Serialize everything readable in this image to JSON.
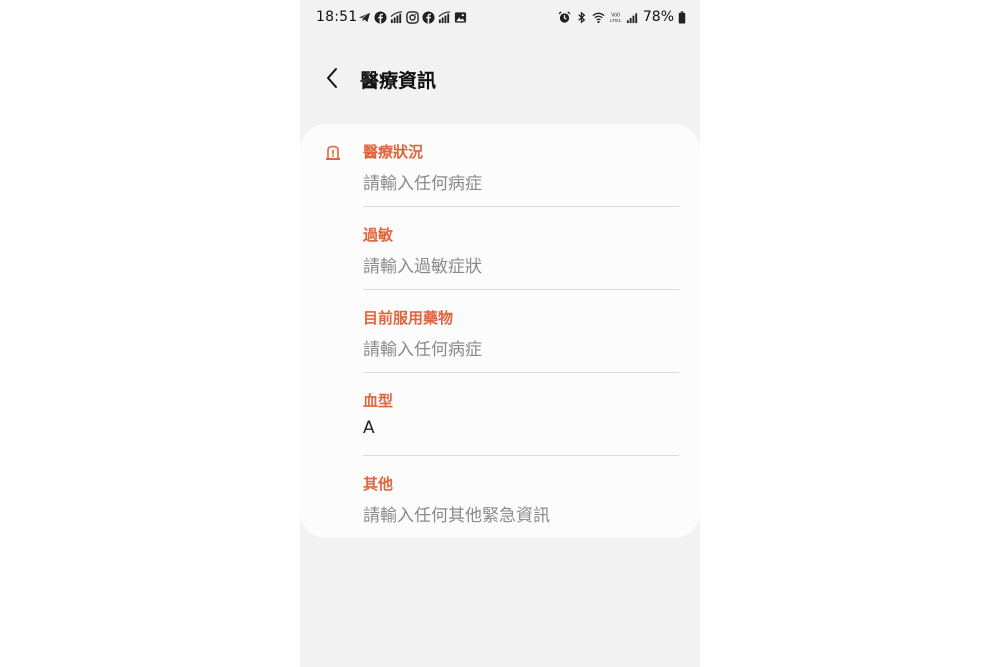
{
  "status_bar": {
    "time": "18:51",
    "battery_percent": "78%",
    "left_icons": [
      "telegram-icon",
      "facebook-icon",
      "signal-icon",
      "instagram-icon",
      "facebook-icon",
      "signal-icon",
      "gallery-icon"
    ],
    "right_icons": [
      "alarm-icon",
      "bluetooth-icon",
      "wifi-icon",
      "volte-icon",
      "signal-bars-icon",
      "battery-icon"
    ]
  },
  "header": {
    "title": "醫療資訊"
  },
  "fields": [
    {
      "label": "醫療狀況",
      "value": "請輸入任何病症",
      "filled": false
    },
    {
      "label": "過敏",
      "value": "請輸入過敏症狀",
      "filled": false
    },
    {
      "label": "目前服用藥物",
      "value": "請輸入任何病症",
      "filled": false
    },
    {
      "label": "血型",
      "value": "A",
      "filled": true
    },
    {
      "label": "其他",
      "value": "請輸入任何其他緊急資訊",
      "filled": false
    }
  ],
  "colors": {
    "accent": "#e0653e",
    "placeholder": "#8a8a8a",
    "background": "#f2f2f2",
    "card": "#fcfcfc"
  }
}
